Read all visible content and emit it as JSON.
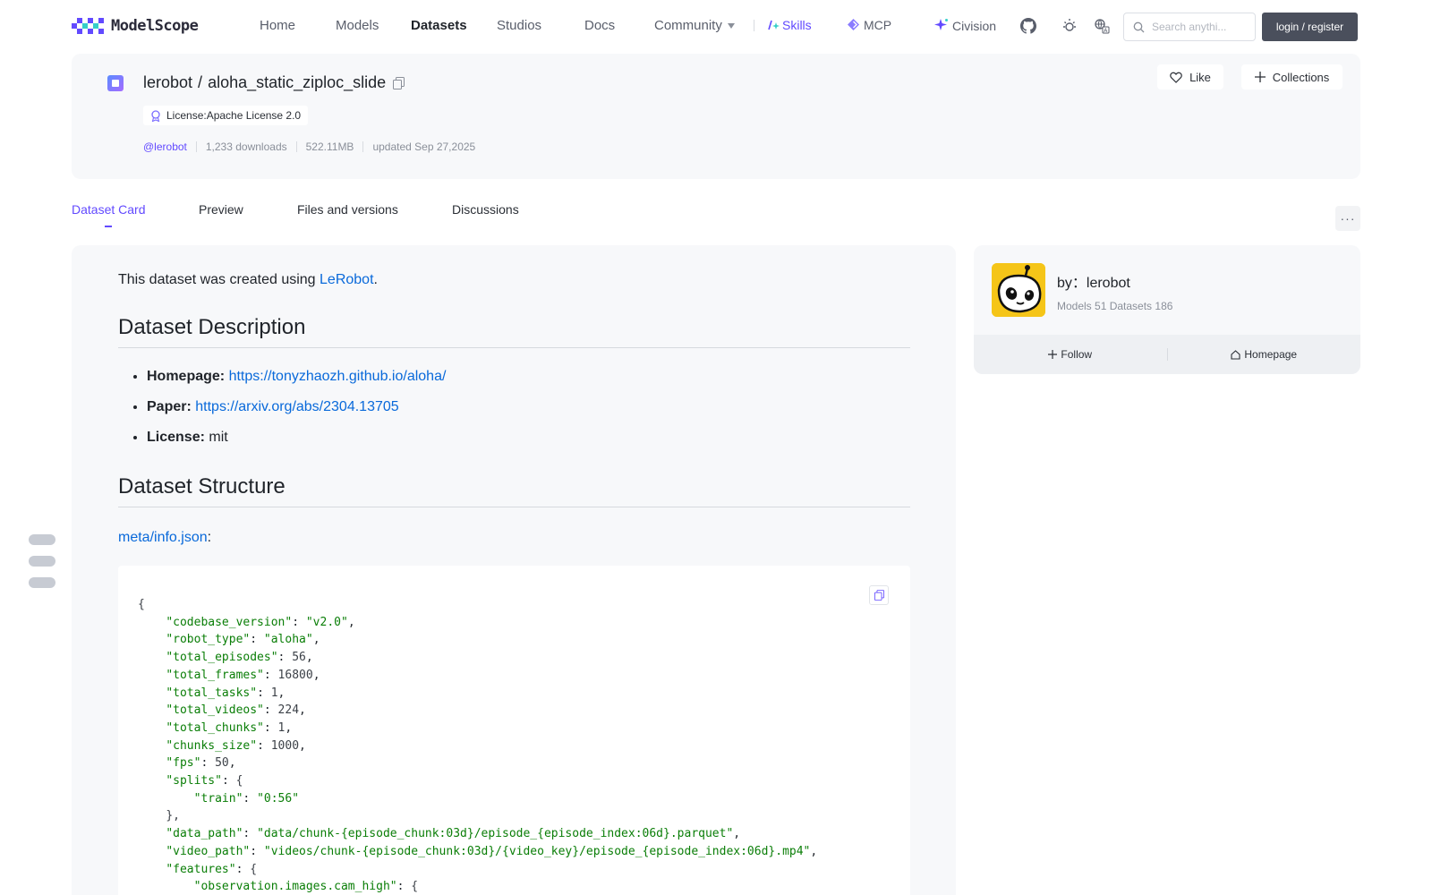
{
  "nav": {
    "logo_text": "ModelScope",
    "items": [
      {
        "label": "Home"
      },
      {
        "label": "Models"
      },
      {
        "label": "Datasets"
      },
      {
        "label": "Studios"
      },
      {
        "label": "Docs"
      },
      {
        "label": "Community"
      },
      {
        "label": "Skills"
      },
      {
        "label": "MCP"
      },
      {
        "label": "Civision"
      }
    ],
    "search_placeholder": "Search anythi...",
    "login_label": "login / register",
    "accent": "#624aff"
  },
  "dataset": {
    "owner": "lerobot",
    "separator": "/",
    "name": "aloha_static_ziploc_slide",
    "license": "License:Apache License 2.0",
    "author_handle": "@lerobot",
    "downloads": "1,233 downloads",
    "size": "522.11MB",
    "updated": "updated Sep 27,2025",
    "like_label": "Like",
    "collections_label": "Collections"
  },
  "tabs": [
    {
      "label": "Dataset Card"
    },
    {
      "label": "Preview"
    },
    {
      "label": "Files and versions"
    },
    {
      "label": "Discussions"
    }
  ],
  "more_label": "···",
  "card": {
    "intro_prefix": "This dataset was created using ",
    "intro_link": "LeRobot",
    "intro_suffix": ".",
    "description_heading": "Dataset Description",
    "bullets": [
      {
        "label": "Homepage:",
        "value": "https://tonyzhaozh.github.io/aloha/",
        "is_link": true
      },
      {
        "label": "Paper:",
        "value": "https://arxiv.org/abs/2304.13705",
        "is_link": true
      },
      {
        "label": "License:",
        "value": "mit",
        "is_link": false
      }
    ],
    "structure_heading": "Dataset Structure",
    "meta_link": "meta/info.json",
    "meta_suffix": ":",
    "code_lines": [
      {
        "indent": 0,
        "key": "",
        "value": "",
        "raw": "{"
      },
      {
        "indent": 1,
        "key": "\"codebase_version\"",
        "value": "\"v2.0\"",
        "type": "s",
        "trail": ","
      },
      {
        "indent": 1,
        "key": "\"robot_type\"",
        "value": "\"aloha\"",
        "type": "s",
        "trail": ","
      },
      {
        "indent": 1,
        "key": "\"total_episodes\"",
        "value": "56",
        "type": "n",
        "trail": ","
      },
      {
        "indent": 1,
        "key": "\"total_frames\"",
        "value": "16800",
        "type": "n",
        "trail": ","
      },
      {
        "indent": 1,
        "key": "\"total_tasks\"",
        "value": "1",
        "type": "n",
        "trail": ","
      },
      {
        "indent": 1,
        "key": "\"total_videos\"",
        "value": "224",
        "type": "n",
        "trail": ","
      },
      {
        "indent": 1,
        "key": "\"total_chunks\"",
        "value": "1",
        "type": "n",
        "trail": ","
      },
      {
        "indent": 1,
        "key": "\"chunks_size\"",
        "value": "1000",
        "type": "n",
        "trail": ","
      },
      {
        "indent": 1,
        "key": "\"fps\"",
        "value": "50",
        "type": "n",
        "trail": ","
      },
      {
        "indent": 1,
        "key": "\"splits\"",
        "value": "{",
        "type": "n",
        "trail": ""
      },
      {
        "indent": 2,
        "key": "\"train\"",
        "value": "\"0:56\"",
        "type": "s",
        "trail": ""
      },
      {
        "indent": 1,
        "key": "",
        "value": "",
        "raw": "},"
      },
      {
        "indent": 1,
        "key": "\"data_path\"",
        "value": "\"data/chunk-{episode_chunk:03d}/episode_{episode_index:06d}.parquet\"",
        "type": "s",
        "trail": ","
      },
      {
        "indent": 1,
        "key": "\"video_path\"",
        "value": "\"videos/chunk-{episode_chunk:03d}/{video_key}/episode_{episode_index:06d}.mp4\"",
        "type": "s",
        "trail": ","
      },
      {
        "indent": 1,
        "key": "\"features\"",
        "value": "{",
        "type": "n",
        "trail": ""
      },
      {
        "indent": 2,
        "key": "\"observation.images.cam_high\"",
        "value": "{",
        "type": "n",
        "trail": ""
      }
    ]
  },
  "side": {
    "by_label": "by：lerobot",
    "counts": "Models 51  Datasets 186",
    "follow_label": "Follow",
    "homepage_label": "Homepage"
  }
}
